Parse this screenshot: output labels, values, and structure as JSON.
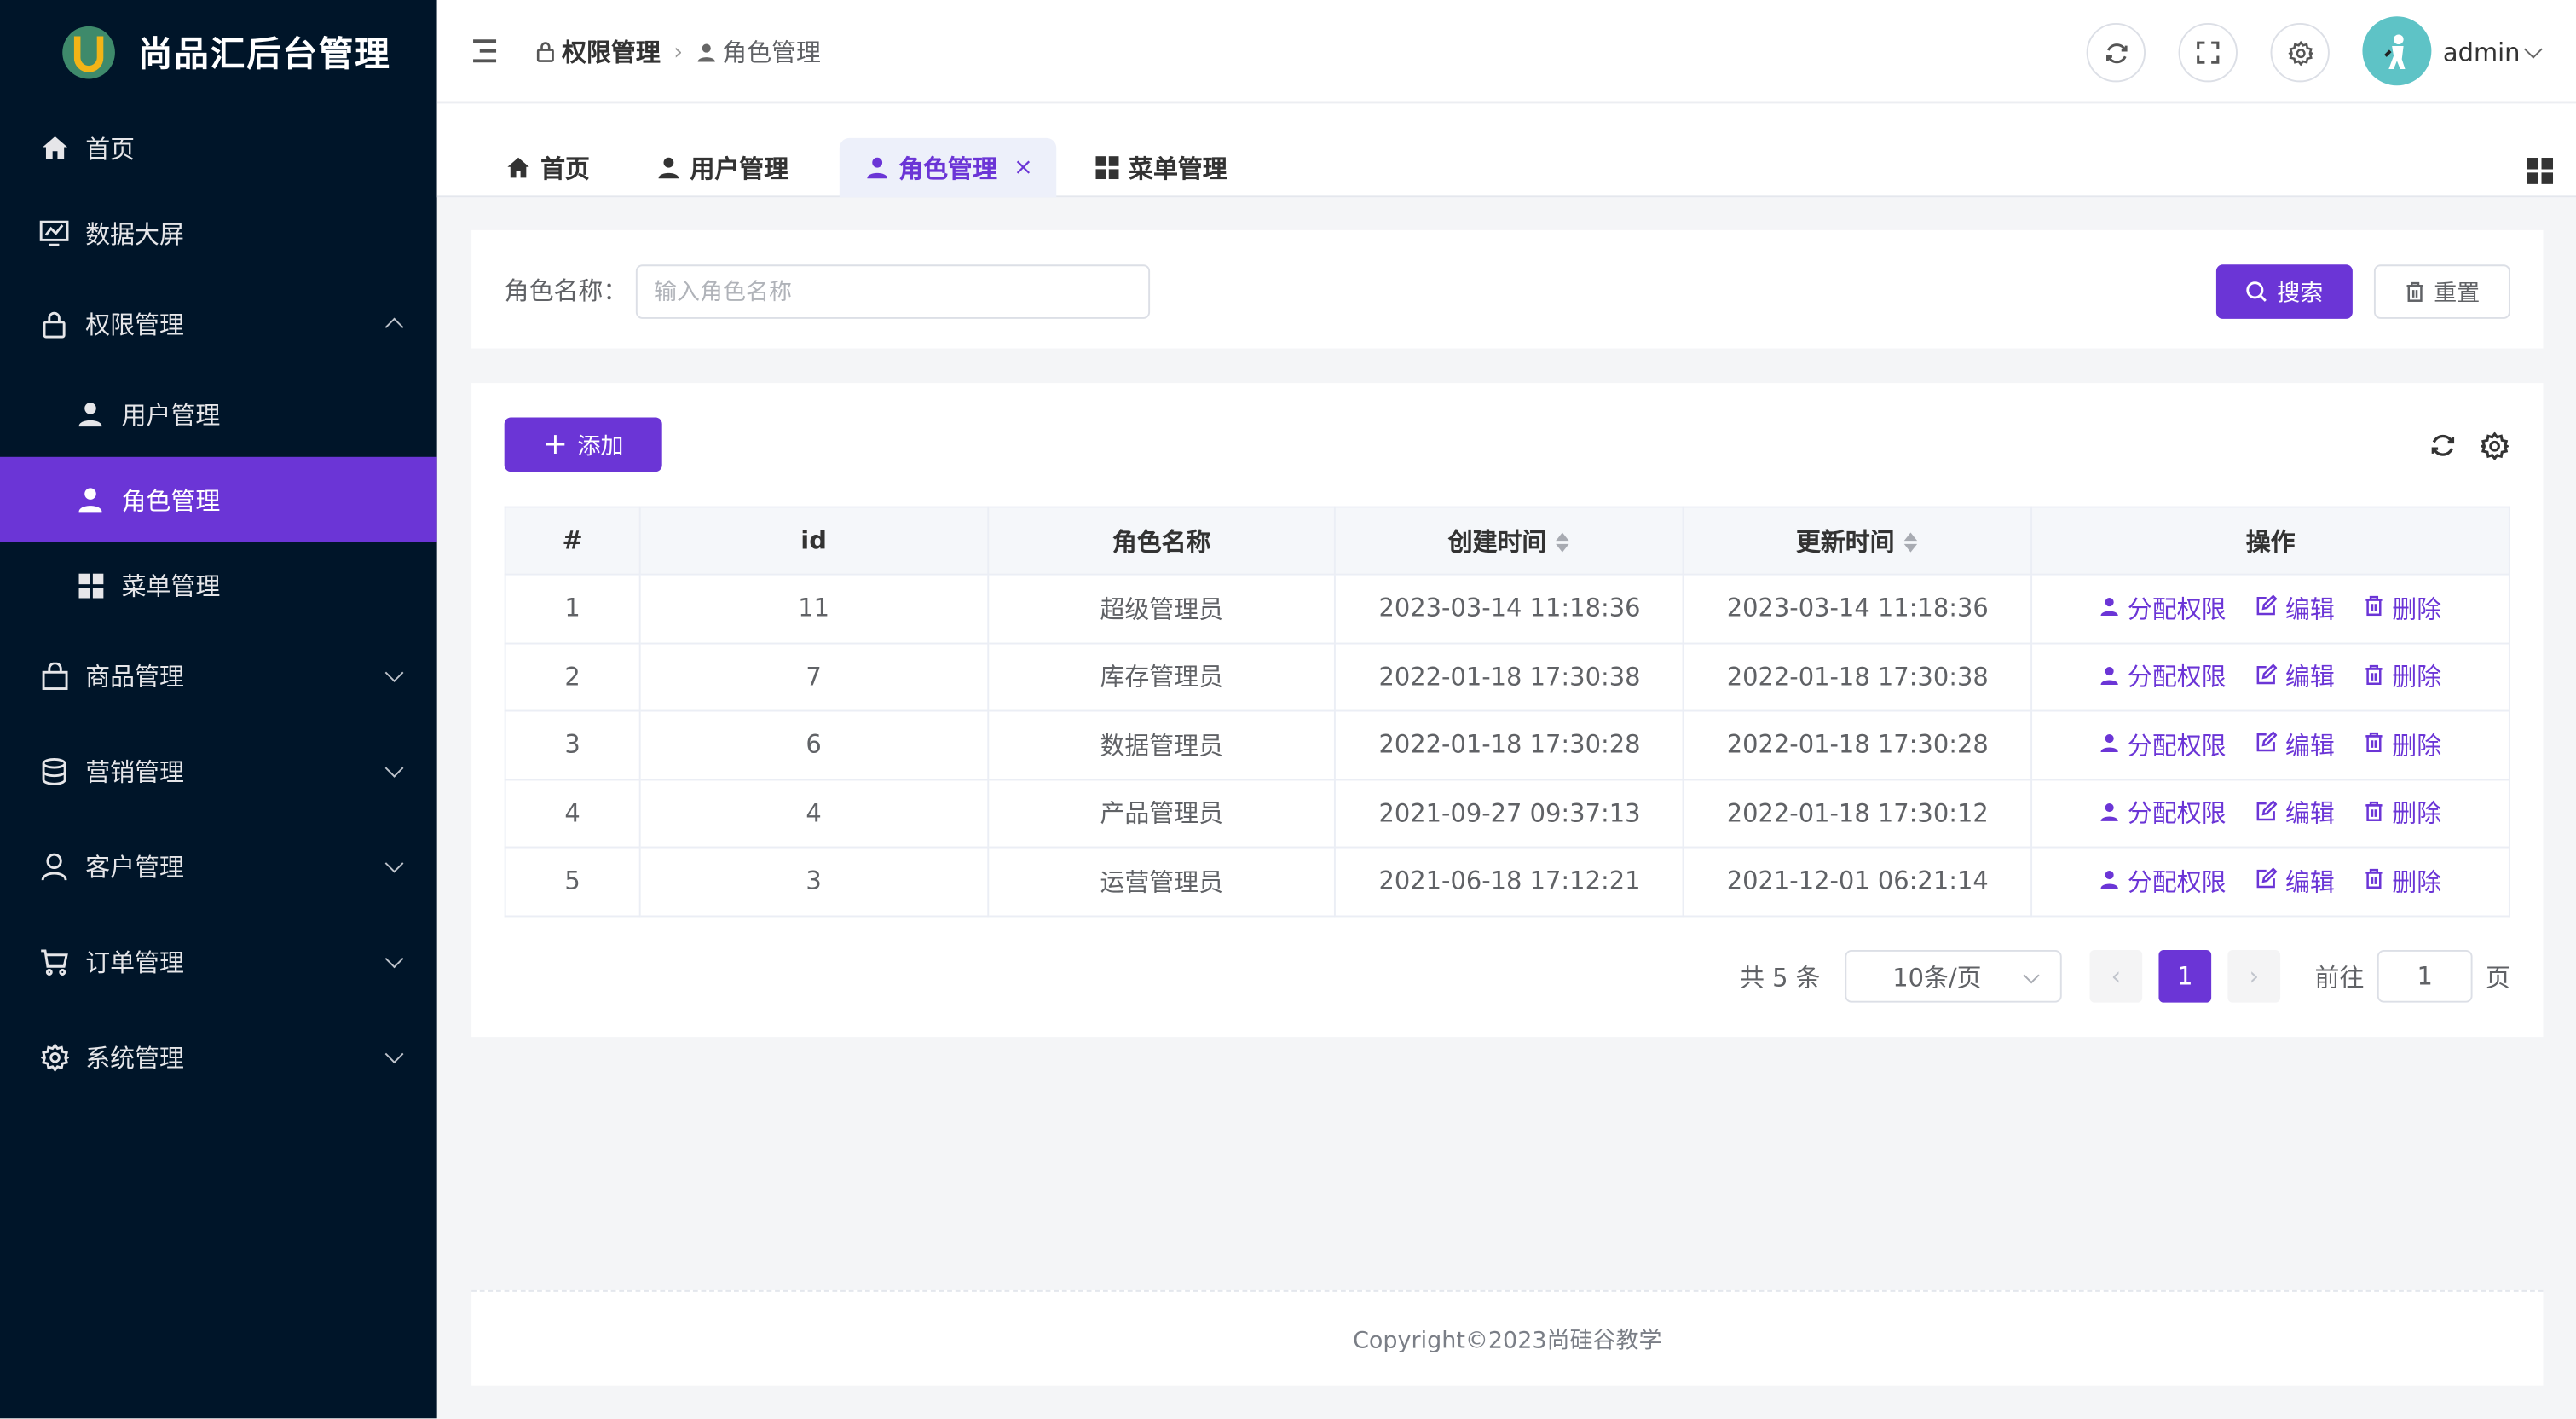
{
  "app": {
    "title": "尚品汇后台管理"
  },
  "sidebar": {
    "items": [
      {
        "label": "首页",
        "icon": "home-icon"
      },
      {
        "label": "数据大屏",
        "icon": "chart-icon"
      },
      {
        "label": "权限管理",
        "icon": "lock-icon",
        "expanded": true
      },
      {
        "label": "用户管理",
        "icon": "user-icon"
      },
      {
        "label": "角色管理",
        "icon": "user-icon",
        "active": true
      },
      {
        "label": "菜单管理",
        "icon": "grid-icon"
      },
      {
        "label": "商品管理",
        "icon": "bag-icon"
      },
      {
        "label": "营销管理",
        "icon": "database-icon"
      },
      {
        "label": "客户管理",
        "icon": "person-outline-icon"
      },
      {
        "label": "订单管理",
        "icon": "cart-icon"
      },
      {
        "label": "系统管理",
        "icon": "gear-icon"
      }
    ]
  },
  "header": {
    "breadcrumb": [
      "权限管理",
      "角色管理"
    ],
    "user": "admin"
  },
  "tabs": [
    {
      "label": "首页",
      "icon": "home-icon"
    },
    {
      "label": "用户管理",
      "icon": "user-icon"
    },
    {
      "label": "角色管理",
      "icon": "user-icon",
      "active": true,
      "close": "×"
    },
    {
      "label": "菜单管理",
      "icon": "grid-icon"
    }
  ],
  "search": {
    "label": "角色名称：",
    "placeholder": "输入角色名称",
    "search_button": "搜索",
    "reset_button": "重置"
  },
  "toolbar": {
    "add_button": "添加"
  },
  "table": {
    "columns": [
      "#",
      "id",
      "角色名称",
      "创建时间",
      "更新时间",
      "操作"
    ],
    "rows": [
      {
        "idx": "1",
        "id": "11",
        "name": "超级管理员",
        "created": "2023-03-14 11:18:36",
        "updated": "2023-03-14 11:18:36"
      },
      {
        "idx": "2",
        "id": "7",
        "name": "库存管理员",
        "created": "2022-01-18 17:30:38",
        "updated": "2022-01-18 17:30:38"
      },
      {
        "idx": "3",
        "id": "6",
        "name": "数据管理员",
        "created": "2022-01-18 17:30:28",
        "updated": "2022-01-18 17:30:28"
      },
      {
        "idx": "4",
        "id": "4",
        "name": "产品管理员",
        "created": "2021-09-27 09:37:13",
        "updated": "2022-01-18 17:30:12"
      },
      {
        "idx": "5",
        "id": "3",
        "name": "运营管理员",
        "created": "2021-06-18 17:12:21",
        "updated": "2021-12-01 06:21:14"
      }
    ],
    "actions": {
      "assign": "分配权限",
      "edit": "编辑",
      "delete": "删除"
    }
  },
  "pagination": {
    "total": "共 5 条",
    "page_size": "10条/页",
    "current": "1",
    "goto_label": "前往",
    "goto_value": "1",
    "page_suffix": "页"
  },
  "footer": {
    "copyright": "Copyright©2023尚硅谷教学"
  },
  "colors": {
    "primary": "#6b35d6",
    "sidebar_bg": "#001529"
  }
}
